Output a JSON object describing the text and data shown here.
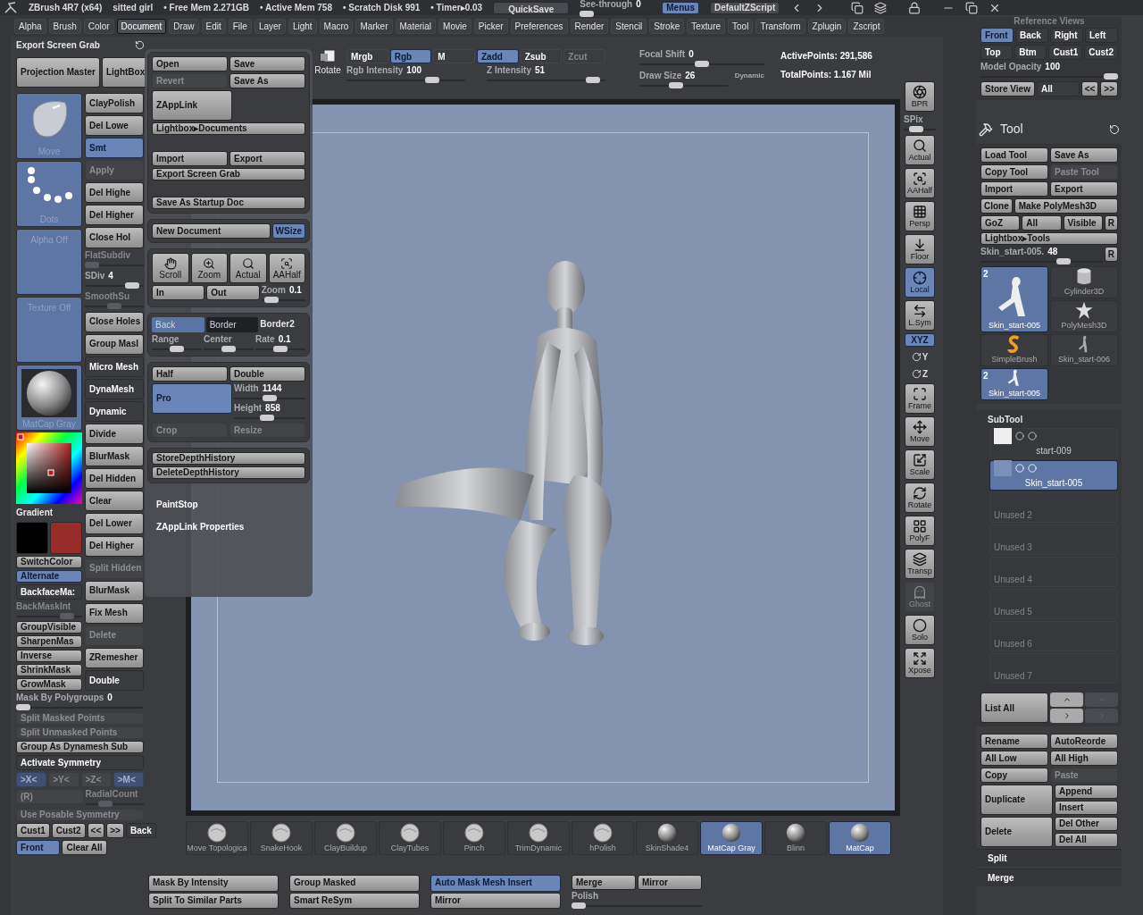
{
  "title_bar": {
    "app": "ZBrush 4R7 (x64)",
    "document": "sitted girl",
    "stats": [
      "• Free Mem 2.271GB",
      "• Active Mem 758",
      "• Scratch Disk 991",
      "• Timer▸0.03"
    ],
    "quicksave": "QuickSave",
    "see_through": {
      "label": "See-through",
      "value": "0",
      "level": 0
    },
    "menus": {
      "label": "Menus",
      "selected": true
    },
    "script": "DefaultZScript"
  },
  "menu_bar": [
    {
      "label": "Alpha",
      "selected": false
    },
    {
      "label": "Brush",
      "selected": false
    },
    {
      "label": "Color",
      "selected": false
    },
    {
      "label": "Document",
      "selected": true
    },
    {
      "label": "Draw",
      "selected": false
    },
    {
      "label": "Edit",
      "selected": false
    },
    {
      "label": "File",
      "selected": false
    },
    {
      "label": "Layer",
      "selected": false
    },
    {
      "label": "Light",
      "selected": false
    },
    {
      "label": "Macro",
      "selected": false
    },
    {
      "label": "Marker",
      "selected": false
    },
    {
      "label": "Material",
      "selected": false
    },
    {
      "label": "Movie",
      "selected": false
    },
    {
      "label": "Picker",
      "selected": false
    },
    {
      "label": "Preferences",
      "selected": false
    },
    {
      "label": "Render",
      "selected": false
    },
    {
      "label": "Stencil",
      "selected": false
    },
    {
      "label": "Stroke",
      "selected": false
    },
    {
      "label": "Texture",
      "selected": false
    },
    {
      "label": "Tool",
      "selected": false
    },
    {
      "label": "Transform",
      "selected": false
    },
    {
      "label": "Zplugin",
      "selected": false
    },
    {
      "label": "Zscript",
      "selected": false
    }
  ],
  "left_panel": {
    "header": "Export Screen Grab",
    "top": [
      {
        "kind": "big",
        "label": "Projection Master"
      },
      {
        "kind": "big",
        "label": "LightBox"
      }
    ],
    "column_a": [
      {
        "kind": "thumb",
        "label": "Move"
      },
      {
        "kind": "thumb",
        "label": "Dots"
      },
      {
        "kind": "thumb",
        "label": "Alpha  Off"
      },
      {
        "kind": "thumb",
        "label": "Texture  Off"
      },
      {
        "kind": "thumb",
        "label": "MatCap  Gray"
      },
      {
        "kind": "picker"
      },
      {
        "kind": "label",
        "label": "Gradient"
      },
      {
        "kind": "swatches",
        "items": [
          {
            "color": "#000000"
          },
          {
            "color": "#9a2b2b"
          }
        ]
      },
      {
        "kind": "button",
        "label": "SwitchColor"
      },
      {
        "kind": "button",
        "label": "Alternate",
        "selected": true
      },
      {
        "kind": "dark",
        "label": "BackfaceMa:"
      },
      {
        "kind": "slider",
        "label": "BackMaskInt",
        "level": 0.85,
        "disabled": true
      },
      {
        "kind": "button",
        "label": "GroupVisible"
      },
      {
        "kind": "button",
        "label": "SharpenMas"
      },
      {
        "kind": "button",
        "label": "Inverse"
      },
      {
        "kind": "button",
        "label": "ShrinkMask"
      },
      {
        "kind": "button",
        "label": "GrowMask"
      }
    ],
    "column_b": [
      {
        "kind": "big",
        "label": "ClayPolish"
      },
      {
        "kind": "button",
        "label": "Del  Lowe"
      },
      {
        "kind": "button",
        "label": "Smt",
        "selected": true
      },
      {
        "kind": "button",
        "label": "Apply",
        "disabled": true
      },
      {
        "kind": "button",
        "label": "Del  Highe"
      },
      {
        "kind": "button",
        "label": "Del  Higher"
      },
      {
        "kind": "button",
        "label": "Close  Hol"
      },
      {
        "kind": "slider",
        "label": "FlatSubdiv",
        "level": 0,
        "disabled": true
      },
      {
        "kind": "slider",
        "label": "SDiv",
        "value": "4",
        "level": 0.9,
        "disabled": false
      },
      {
        "kind": "slider",
        "label": "SmoothSu",
        "level": 0.5,
        "disabled": true
      },
      {
        "kind": "button",
        "label": "Close  Holes"
      },
      {
        "kind": "button",
        "label": "Group  Masl"
      },
      {
        "kind": "darkbig",
        "label": "Micro  Mesh"
      },
      {
        "kind": "darkbig",
        "label": "DynaMesh"
      },
      {
        "kind": "dark",
        "label": "Dynamic"
      },
      {
        "kind": "big",
        "label": "Divide"
      },
      {
        "kind": "button",
        "label": "BlurMask"
      },
      {
        "kind": "button",
        "label": "Del  Hidden"
      },
      {
        "kind": "button",
        "label": "Clear"
      },
      {
        "kind": "button",
        "label": "Del  Lower"
      },
      {
        "kind": "button",
        "label": "Del  Higher"
      },
      {
        "kind": "button",
        "label": "Split  Hidden",
        "disabled": true
      },
      {
        "kind": "button",
        "label": "BlurMask"
      },
      {
        "kind": "button",
        "label": "Fix  Mesh"
      },
      {
        "kind": "button",
        "label": "Delete",
        "disabled": true
      },
      {
        "kind": "big",
        "label": "ZRemesher"
      },
      {
        "kind": "dark",
        "label": "Double"
      }
    ],
    "rows": [
      {
        "kind": "slider",
        "label": "Mask By Polygroups",
        "value": "0",
        "level": 0,
        "disabled": false
      },
      {
        "kind": "button",
        "label": "Split  Masked  Points",
        "disabled": true
      },
      {
        "kind": "button",
        "label": "Split  Unmasked  Points",
        "disabled": true
      },
      {
        "kind": "button",
        "label": "Group  As  Dynamesh  Sub"
      },
      {
        "kind": "dark",
        "label": "Activate  Symmetry"
      },
      {
        "kind": "row",
        "items": [
          {
            "kind": "button",
            "label": ">X<",
            "selected": true,
            "disabled": true
          },
          {
            "kind": "button",
            "label": ">Y<",
            "selected": false,
            "disabled": true
          },
          {
            "kind": "button",
            "label": ">Z<",
            "selected": false,
            "disabled": true
          },
          {
            "kind": "button",
            "label": ">M<",
            "selected": true,
            "disabled": true
          }
        ]
      },
      {
        "kind": "row",
        "items": [
          {
            "kind": "button",
            "label": "(R)",
            "disabled": true
          },
          {
            "kind": "slider",
            "label": "RadialCount",
            "level": 0.3,
            "disabled": true
          }
        ]
      },
      {
        "kind": "button",
        "label": "Use  Posable  Symmetry",
        "disabled": true
      },
      {
        "kind": "row",
        "items": [
          {
            "kind": "button",
            "label": "Cust1"
          },
          {
            "kind": "button",
            "label": "Cust2"
          },
          {
            "kind": "mini",
            "label": "<<"
          },
          {
            "kind": "mini",
            "label": ">>"
          },
          {
            "kind": "dark",
            "label": "Back"
          }
        ]
      },
      {
        "kind": "row",
        "items": [
          {
            "kind": "button",
            "label": "Front",
            "selected": true
          },
          {
            "kind": "button",
            "label": "Clear  All"
          },
          {
            "kind": "spacer"
          }
        ]
      }
    ]
  },
  "document_popup": {
    "groups": [
      {
        "items": [
          {
            "kind": "row",
            "items": [
              {
                "kind": "button",
                "label": "Open"
              },
              {
                "kind": "button",
                "label": "Save"
              }
            ]
          },
          {
            "kind": "row",
            "items": [
              {
                "kind": "button",
                "label": "Revert",
                "disabled": true
              },
              {
                "kind": "button",
                "label": "Save  As"
              }
            ]
          },
          {
            "kind": "row",
            "items": [
              {
                "kind": "big",
                "label": "ZAppLink"
              },
              {
                "kind": "spacer"
              }
            ]
          },
          {
            "kind": "button",
            "label": "Lightbox▸Documents"
          },
          {
            "kind": "gap"
          },
          {
            "kind": "row",
            "items": [
              {
                "kind": "button",
                "label": "Import"
              },
              {
                "kind": "button",
                "label": "Export"
              }
            ]
          },
          {
            "kind": "button",
            "label": "Export  Screen  Grab"
          },
          {
            "kind": "gap"
          },
          {
            "kind": "button",
            "label": "Save  As  Startup  Doc"
          }
        ]
      },
      {
        "items": [
          {
            "kind": "row",
            "items": [
              {
                "kind": "button",
                "label": "New  Document"
              },
              {
                "kind": "mini",
                "label": "WSize",
                "selected": true
              }
            ]
          }
        ]
      },
      {
        "items": [
          {
            "kind": "row",
            "items": [
              {
                "kind": "tool",
                "label": "Scroll"
              },
              {
                "kind": "tool",
                "label": "Zoom"
              },
              {
                "kind": "tool",
                "label": "Actual"
              },
              {
                "kind": "tool",
                "label": "AAHalf"
              }
            ]
          },
          {
            "kind": "row",
            "items": [
              {
                "kind": "button",
                "label": "In"
              },
              {
                "kind": "button",
                "label": "Out"
              },
              {
                "kind": "slider",
                "label": "Zoom",
                "value": "0.1",
                "level": 0.1,
                "disabled": false
              }
            ]
          }
        ]
      },
      {
        "items": [
          {
            "kind": "row",
            "items": [
              {
                "kind": "color",
                "label": "Back",
                "color": "#5a74a3"
              },
              {
                "kind": "color",
                "label": "Border",
                "color": "#1f2023"
              },
              {
                "kind": "label",
                "label": "Border2"
              }
            ]
          },
          {
            "kind": "row",
            "items": [
              {
                "kind": "slider",
                "label": "Range",
                "level": 0.5,
                "disabled": false
              },
              {
                "kind": "slider",
                "label": "Center",
                "level": 0.5,
                "disabled": false
              },
              {
                "kind": "slider",
                "label": "Rate",
                "value": "0.1",
                "level": 0.5,
                "disabled": false
              }
            ]
          }
        ]
      },
      {
        "items": [
          {
            "kind": "row",
            "items": [
              {
                "kind": "button",
                "label": "Half"
              },
              {
                "kind": "button",
                "label": "Double"
              }
            ]
          },
          {
            "kind": "row",
            "items": [
              {
                "kind": "big",
                "label": "Pro",
                "selected": true
              },
              {
                "kind": "stack",
                "items": [
                  {
                    "kind": "slider",
                    "label": "Width",
                    "value": "1144",
                    "level": 0.5,
                    "disabled": false
                  },
                  {
                    "kind": "slider",
                    "label": "Height",
                    "value": "858",
                    "level": 0.45,
                    "disabled": false
                  }
                ]
              }
            ]
          },
          {
            "kind": "row",
            "items": [
              {
                "kind": "button",
                "label": "Crop",
                "disabled": true
              },
              {
                "kind": "button",
                "label": "Resize",
                "disabled": true
              }
            ]
          }
        ]
      },
      {
        "items": [
          {
            "kind": "button",
            "label": "StoreDepthHistory"
          },
          {
            "kind": "button",
            "label": "DeleteDepthHistory"
          }
        ]
      }
    ],
    "labels": [
      "PaintStop",
      "ZAppLink  Properties"
    ]
  },
  "toolbar": {
    "rotate": "Rotate",
    "row1": [
      {
        "label": "Mrgb",
        "selected": false,
        "disabled": false
      },
      {
        "label": "Rgb",
        "selected": true,
        "disabled": false
      },
      {
        "label": "M",
        "selected": false,
        "disabled": false
      },
      {
        "label": "Zadd",
        "selected": true,
        "disabled": false
      },
      {
        "label": "Zsub",
        "selected": false,
        "disabled": false
      },
      {
        "label": "Zcut",
        "selected": false,
        "disabled": true
      }
    ],
    "rgb_intensity": {
      "label": "Rgb  Intensity",
      "value": "100",
      "level": 0.75
    },
    "z_intensity": {
      "label": "Z  Intensity",
      "value": "51",
      "level": 0.95
    },
    "focal_shift": {
      "label": "Focal  Shift",
      "value": "0",
      "level": 0.5
    },
    "draw_size": {
      "label": "Draw  Size",
      "value": "26",
      "level": 0.4
    },
    "dynamic": "Dynamic",
    "active_points": "ActivePoints:  291,586",
    "total_points": "TotalPoints:  1.167  Mil"
  },
  "right_shelf": [
    {
      "label": "BPR",
      "kind": "button",
      "selected": false,
      "disabled": false
    },
    {
      "label": "SPix",
      "kind": "slider",
      "level": 0.3
    },
    {
      "label": "Actual",
      "kind": "button",
      "selected": false,
      "disabled": false
    },
    {
      "label": "AAHalf",
      "kind": "button",
      "selected": false,
      "disabled": false
    },
    {
      "label": "Persp",
      "kind": "button",
      "selected": false,
      "disabled": false
    },
    {
      "label": "Floor",
      "kind": "button",
      "selected": false,
      "disabled": false
    },
    {
      "label": "Local",
      "kind": "button",
      "selected": true,
      "disabled": false
    },
    {
      "label": "L.Sym",
      "kind": "button",
      "selected": false,
      "disabled": false
    },
    {
      "label": "XYZ",
      "kind": "small",
      "selected": true
    },
    {
      "label": "Y",
      "kind": "axis"
    },
    {
      "label": "Z",
      "kind": "axis"
    },
    {
      "label": "Frame",
      "kind": "button",
      "selected": false,
      "disabled": false
    },
    {
      "label": "Move",
      "kind": "button",
      "selected": false,
      "disabled": false
    },
    {
      "label": "Scale",
      "kind": "button",
      "selected": false,
      "disabled": false
    },
    {
      "label": "Rotate",
      "kind": "button",
      "selected": false,
      "disabled": false
    },
    {
      "label": "PolyF",
      "kind": "button",
      "selected": false,
      "disabled": false
    },
    {
      "label": "Transp",
      "kind": "button",
      "selected": false,
      "disabled": false
    },
    {
      "label": "Ghost",
      "kind": "button",
      "selected": false,
      "disabled": true
    },
    {
      "label": "Solo",
      "kind": "button",
      "selected": false,
      "disabled": false
    },
    {
      "label": "Xpose",
      "kind": "button",
      "selected": false,
      "disabled": false
    }
  ],
  "right_panel": {
    "reference_views": {
      "title": "Reference Views",
      "items": [
        {
          "kind": "row",
          "items": [
            {
              "kind": "button",
              "label": "Front",
              "selected": true
            },
            {
              "kind": "dark",
              "label": "Back"
            },
            {
              "kind": "dark",
              "label": "Right"
            },
            {
              "kind": "dark",
              "label": "Left"
            }
          ]
        },
        {
          "kind": "row",
          "items": [
            {
              "kind": "dark",
              "label": "Top"
            },
            {
              "kind": "dark",
              "label": "Btm"
            },
            {
              "kind": "dark",
              "label": "Cust1"
            },
            {
              "kind": "dark",
              "label": "Cust2"
            }
          ]
        },
        {
          "kind": "slider",
          "label": "Model  Opacity",
          "value": "100",
          "level": 1,
          "disabled": false
        },
        {
          "kind": "row",
          "items": [
            {
              "kind": "button",
              "label": "Store  View"
            },
            {
              "kind": "dark",
              "label": "All"
            },
            {
              "kind": "mini",
              "label": "<<"
            },
            {
              "kind": "mini",
              "label": ">>"
            }
          ]
        }
      ]
    },
    "tool": {
      "title": "Tool",
      "items": [
        {
          "kind": "row",
          "items": [
            {
              "kind": "button",
              "label": "Load  Tool"
            },
            {
              "kind": "button",
              "label": "Save  As"
            }
          ]
        },
        {
          "kind": "row",
          "items": [
            {
              "kind": "button",
              "label": "Copy  Tool"
            },
            {
              "kind": "button",
              "label": "Paste  Tool",
              "disabled": true
            }
          ]
        },
        {
          "kind": "row",
          "items": [
            {
              "kind": "button",
              "label": "Import"
            },
            {
              "kind": "button",
              "label": "Export"
            }
          ]
        },
        {
          "kind": "row",
          "items": [
            {
              "kind": "mini",
              "label": "Clone"
            },
            {
              "kind": "button",
              "label": "Make  PolyMesh3D"
            }
          ]
        },
        {
          "kind": "row",
          "items": [
            {
              "kind": "button",
              "label": "GoZ"
            },
            {
              "kind": "button",
              "label": "All"
            },
            {
              "kind": "button",
              "label": "Visible"
            },
            {
              "kind": "mini",
              "label": "R"
            }
          ]
        },
        {
          "kind": "button",
          "label": "Lightbox▸Tools"
        },
        {
          "kind": "row",
          "items": [
            {
              "kind": "slider",
              "label": "Skin_start-005.",
              "value": "48",
              "level": 0.7,
              "disabled": false
            },
            {
              "kind": "mini",
              "label": "R"
            }
          ]
        }
      ],
      "thumbnails": [
        {
          "label": "Skin_start-005",
          "selected": true,
          "badge": "2"
        },
        {
          "label": "Cylinder3D",
          "selected": false
        },
        {
          "label": "PolyMesh3D",
          "selected": false
        },
        {
          "label": "SimpleBrush",
          "selected": false
        },
        {
          "label": "Skin_start-006",
          "selected": false
        },
        {
          "label": "Skin_start-005",
          "selected": true,
          "badge": "2"
        }
      ]
    },
    "subtool": {
      "title": "SubTool",
      "items": [
        {
          "label": "start-009",
          "selected": false,
          "disabled": false
        },
        {
          "label": "Skin_start-005",
          "selected": true,
          "disabled": false
        },
        {
          "label": "Unused  2",
          "selected": false,
          "disabled": true
        },
        {
          "label": "Unused  3",
          "selected": false,
          "disabled": true
        },
        {
          "label": "Unused  4",
          "selected": false,
          "disabled": true
        },
        {
          "label": "Unused  5",
          "selected": false,
          "disabled": true
        },
        {
          "label": "Unused  6",
          "selected": false,
          "disabled": true
        },
        {
          "label": "Unused  7",
          "selected": false,
          "disabled": true
        }
      ],
      "list_all": "List  All",
      "buttons": [
        {
          "kind": "row",
          "items": [
            {
              "kind": "button",
              "label": "Rename"
            },
            {
              "kind": "button",
              "label": "AutoReorde"
            }
          ]
        },
        {
          "kind": "row",
          "items": [
            {
              "kind": "button",
              "label": "All  Low"
            },
            {
              "kind": "button",
              "label": "All  High"
            }
          ]
        },
        {
          "kind": "row",
          "items": [
            {
              "kind": "button",
              "label": "Copy"
            },
            {
              "kind": "button",
              "label": "Paste",
              "disabled": true
            }
          ]
        },
        {
          "kind": "row",
          "items": [
            {
              "kind": "big",
              "label": "Duplicate"
            },
            {
              "kind": "stack",
              "items": [
                {
                  "kind": "button",
                  "label": "Append"
                },
                {
                  "kind": "button",
                  "label": "Insert"
                }
              ]
            }
          ]
        },
        {
          "kind": "row",
          "items": [
            {
              "kind": "big",
              "label": "Delete"
            },
            {
              "kind": "stack",
              "items": [
                {
                  "kind": "button",
                  "label": "Del  Other"
                },
                {
                  "kind": "button",
                  "label": "Del  All"
                }
              ]
            }
          ]
        }
      ],
      "sections": [
        "Split",
        "Merge"
      ]
    }
  },
  "bottom_strip": [
    {
      "label": "Move  Topologica",
      "kind": "brush",
      "selected": false
    },
    {
      "label": "SnakeHook",
      "kind": "brush",
      "selected": false
    },
    {
      "label": "ClayBuildup",
      "kind": "brush",
      "selected": false
    },
    {
      "label": "ClayTubes",
      "kind": "brush",
      "selected": false
    },
    {
      "label": "Pinch",
      "kind": "brush",
      "selected": false
    },
    {
      "label": "TrimDynamic",
      "kind": "brush",
      "selected": false
    },
    {
      "label": "hPolish",
      "kind": "brush",
      "selected": false
    },
    {
      "label": "SkinShade4",
      "kind": "material",
      "selected": false
    },
    {
      "label": "MatCap  Gray",
      "kind": "material",
      "selected": true
    },
    {
      "label": "Blinn",
      "kind": "material",
      "selected": false
    },
    {
      "label": "MatCap",
      "kind": "material",
      "selected": true
    }
  ],
  "bottom_buttons": [
    [
      {
        "kind": "button",
        "label": "Mask  By  Intensity"
      },
      {
        "kind": "button",
        "label": "Split  To  Similar  Parts"
      }
    ],
    [
      {
        "kind": "button",
        "label": "Group  Masked"
      },
      {
        "kind": "button",
        "label": "Smart  ReSym"
      }
    ],
    [
      {
        "kind": "button",
        "label": "Auto  Mask  Mesh  Insert",
        "selected": true
      },
      {
        "kind": "button",
        "label": "Mirror"
      }
    ],
    [
      {
        "kind": "row",
        "items": [
          {
            "kind": "button",
            "label": "Merge"
          },
          {
            "kind": "button",
            "label": "Mirror"
          }
        ]
      },
      {
        "kind": "slider",
        "label": "Polish",
        "level": 0,
        "disabled": false
      }
    ]
  ]
}
